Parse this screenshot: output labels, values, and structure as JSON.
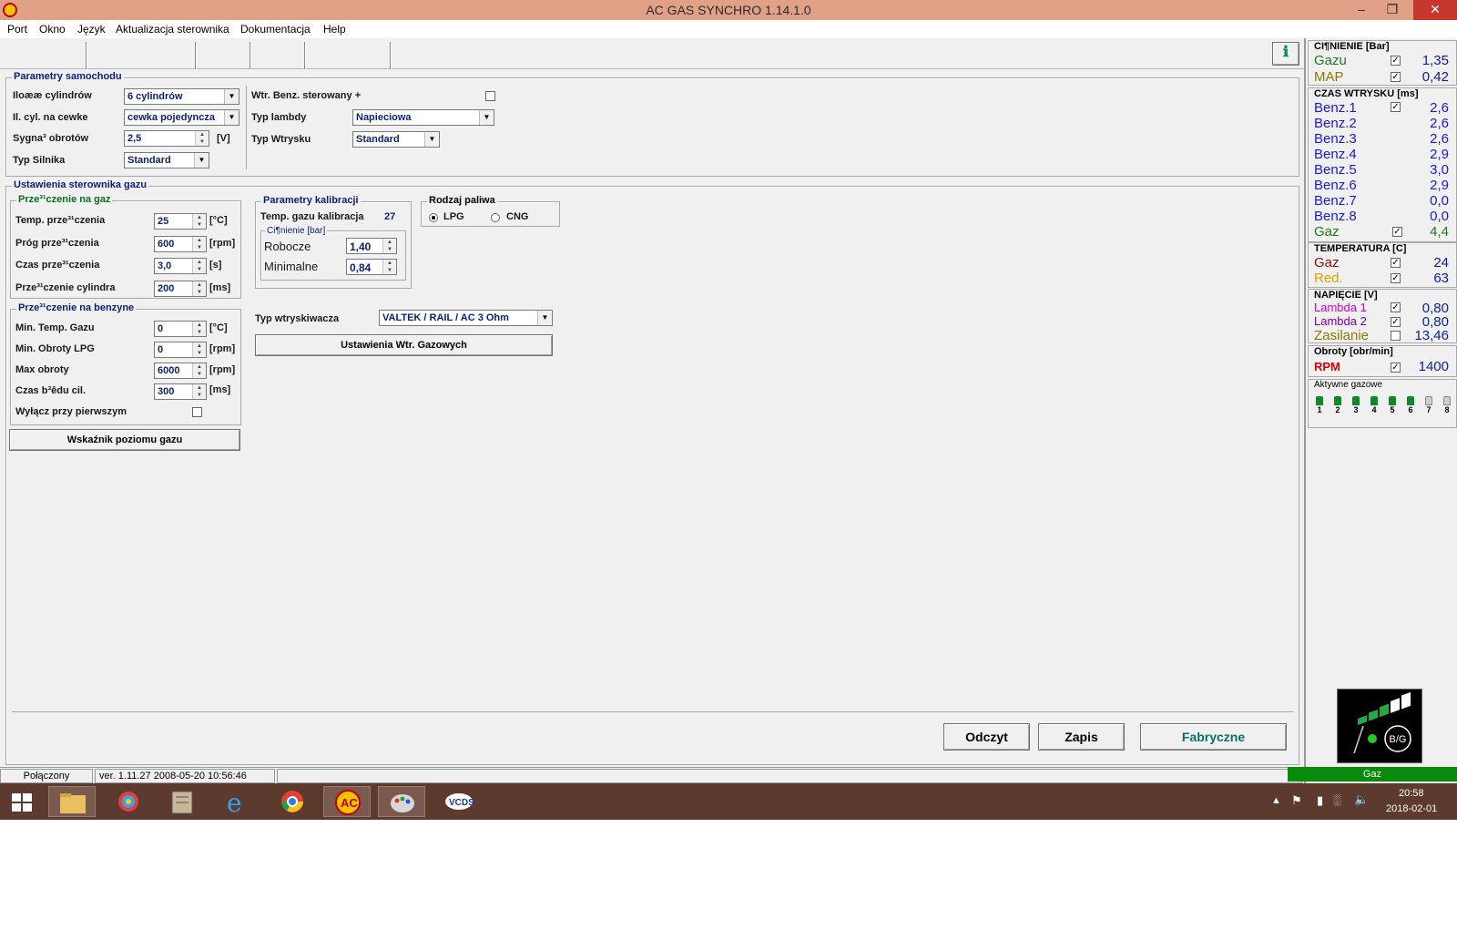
{
  "window": {
    "title": "AC GAS SYNCHRO     1.14.1.0",
    "controls": [
      "–",
      "❐",
      "✕"
    ]
  },
  "menu": [
    "Port",
    "Okno",
    "Język",
    "Aktualizacja sterownika",
    "Dokumentacja",
    "Help"
  ],
  "car_params": {
    "title": "Parametry samochodu",
    "cylinders_label": "Iloææ cylindrów",
    "cylinders_value": "6 cylindrów",
    "coil_label": "Il. cyl. na cewke",
    "coil_value": "cewka pojedyncza",
    "rpm_signal_label": "Sygna³ obrotów",
    "rpm_signal_value": "2,5",
    "rpm_signal_unit": "[V]",
    "engine_type_label": "Typ Silnika",
    "engine_type_value": "Standard",
    "benz_ctrl_label": "Wtr. Benz. sterowany +",
    "lambda_label": "Typ lambdy",
    "lambda_value": "Napieciowa",
    "injection_label": "Typ Wtrysku",
    "injection_value": "Standard"
  },
  "gas_ctrl": {
    "title": "Ustawienia sterownika gazu",
    "switch_gas": {
      "title": "Prze³¹czenie na gaz",
      "rows": [
        {
          "label": "Temp. prze³¹czenia",
          "value": "25",
          "unit": "[°C]"
        },
        {
          "label": "Próg prze³¹czenia",
          "value": "600",
          "unit": "[rpm]"
        },
        {
          "label": "Czas prze³¹czenia",
          "value": "3,0",
          "unit": "[s]"
        },
        {
          "label": "Prze³¹czenie cylindra",
          "value": "200",
          "unit": "[ms]"
        }
      ]
    },
    "switch_benz": {
      "title": "Prze³¹czenie na benzyne",
      "rows": [
        {
          "label": "Min. Temp. Gazu",
          "value": "0",
          "unit": "[°C]"
        },
        {
          "label": "Min. Obroty LPG",
          "value": "0",
          "unit": "[rpm]"
        },
        {
          "label": "Max obroty",
          "value": "6000",
          "unit": "[rpm]"
        },
        {
          "label": "Czas b³êdu cil.",
          "value": "300",
          "unit": "[ms]"
        }
      ],
      "first_off_label": "Wyłącz przy pierwszym"
    },
    "level_button": "Wskaźnik poziomu gazu",
    "calib": {
      "title": "Parametry kalibracji",
      "temp_label": "Temp. gazu kalibracja",
      "temp_value": "27",
      "pressure_title": "Ci¶nienie [bar]",
      "working_label": "Robocze",
      "working_value": "1,40",
      "min_label": "Minimalne",
      "min_value": "0,84"
    },
    "fuel": {
      "title": "Rodzaj paliwa",
      "opt1": "LPG",
      "opt2": "CNG"
    },
    "injector_label": "Typ wtryskiwacza",
    "injector_value": "VALTEK / RAIL / AC 3 Ohm",
    "injector_button": "Ustawienia Wtr. Gazowych"
  },
  "buttons": {
    "read": "Odczyt",
    "write": "Zapis",
    "factory": "Fabryczne"
  },
  "status": {
    "connection": "Połączony",
    "version": "ver. 1.11.27   2008-05-20  10:56:46",
    "mode": "Gaz"
  },
  "right": {
    "pressure": {
      "title": "CI¶NIENIE [Bar]",
      "rows": [
        {
          "name": "Gazu",
          "value": "1,35",
          "color": "#1f7a1f"
        },
        {
          "name": "MAP",
          "value": "0,42",
          "color": "#8a7a00"
        }
      ]
    },
    "inj_time": {
      "title": "CZAS WTRYSKU  [ms]",
      "rows": [
        {
          "name": "Benz.1",
          "value": "2,6"
        },
        {
          "name": "Benz.2",
          "value": "2,6"
        },
        {
          "name": "Benz.3",
          "value": "2,6"
        },
        {
          "name": "Benz.4",
          "value": "2,9"
        },
        {
          "name": "Benz.5",
          "value": "3,0"
        },
        {
          "name": "Benz.6",
          "value": "2,9"
        },
        {
          "name": "Benz.7",
          "value": "0,0"
        },
        {
          "name": "Benz.8",
          "value": "0,0"
        },
        {
          "name": "Gaz",
          "value": "4,4"
        }
      ]
    },
    "temperature": {
      "title": "TEMPERATURA  [C]",
      "rows": [
        {
          "name": "Gaz",
          "value": "24",
          "color": "#8a1010"
        },
        {
          "name": "Red.",
          "value": "63",
          "color": "#e0a000"
        }
      ]
    },
    "voltage": {
      "title": "NAPIĘCIE  [V]",
      "rows": [
        {
          "name": "Lambda 1",
          "value": "0,80",
          "color": "#d000d0"
        },
        {
          "name": "Lambda 2",
          "value": "0,80",
          "color": "#8000a0"
        },
        {
          "name": "Zasilanie",
          "value": "13,46",
          "color": "#8a7a00"
        }
      ]
    },
    "rpm": {
      "title": "Obroty [obr/min]",
      "name": "RPM",
      "value": "1400"
    },
    "active": {
      "title": "Aktywne gazowe",
      "nums": [
        "1",
        "2",
        "3",
        "4",
        "5",
        "6",
        "7",
        "8"
      ]
    },
    "bg_label": "B/G"
  },
  "tray": {
    "time": "20:58",
    "date": "2018-02-01"
  }
}
